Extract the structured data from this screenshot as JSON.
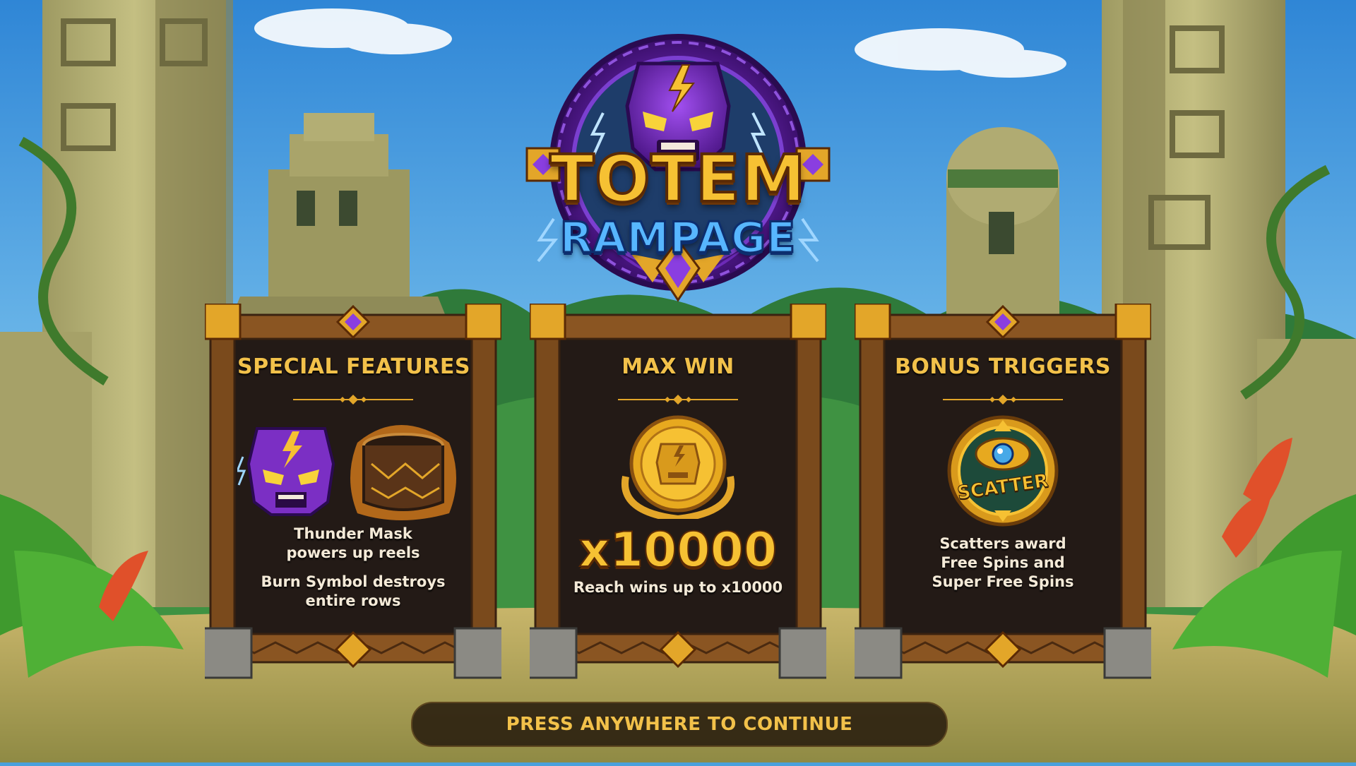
{
  "game": {
    "title_line1": "TOTEM",
    "title_line2": "RAMPAGE"
  },
  "panels": [
    {
      "title": "SPECIAL FEATURES",
      "icons": [
        "thunder-mask-icon",
        "burn-drum-icon"
      ],
      "desc1": "Thunder Mask powers up reels",
      "desc2": "Burn Symbol destroys entire rows"
    },
    {
      "title": "MAX WIN",
      "icons": [
        "gold-coin-icon"
      ],
      "value": "x10000",
      "desc1": "Reach wins up to x10000"
    },
    {
      "title": "BONUS TRIGGERS",
      "icons": [
        "scatter-icon"
      ],
      "scatter_label": "SCATTER",
      "desc1": "Scatters award Free Spins and Super Free Spins"
    }
  ],
  "continue_label": "PRESS ANYWHERE TO CONTINUE",
  "colors": {
    "gold": "#f6c133",
    "purple": "#7b2fc4",
    "panel_bg": "#231a16",
    "wood": "#7a4a1c"
  }
}
